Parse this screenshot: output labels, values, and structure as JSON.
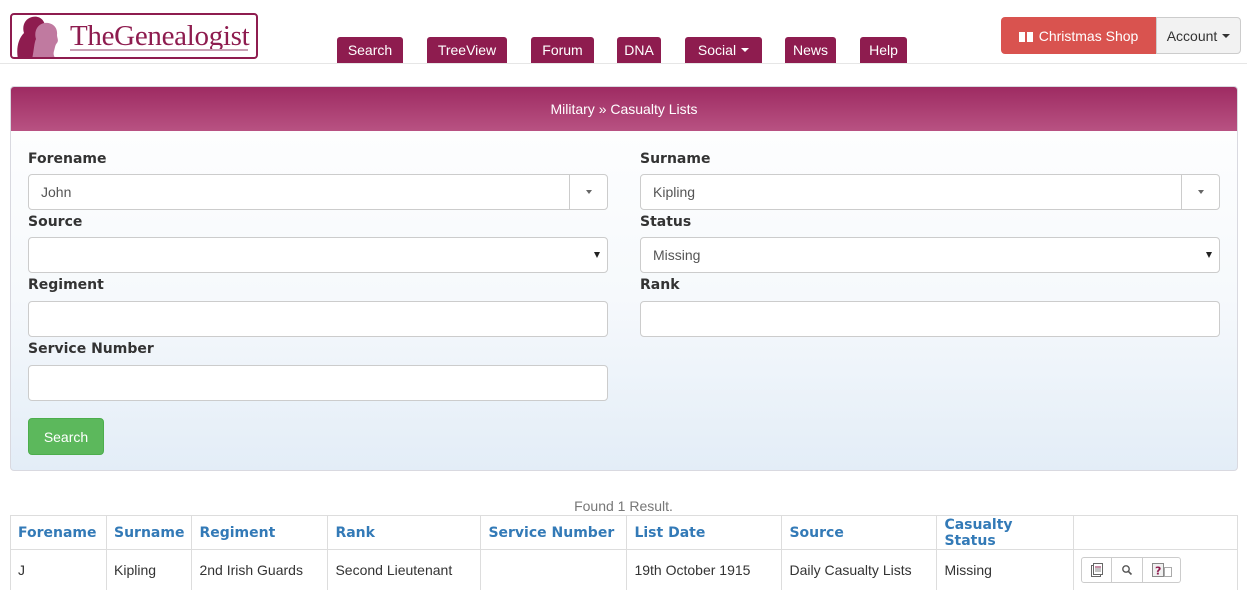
{
  "header": {
    "logo_text": "TheGenealogist",
    "nav": [
      {
        "label": "Search"
      },
      {
        "label": "TreeView"
      },
      {
        "label": "Forum"
      },
      {
        "label": "DNA"
      },
      {
        "label": "Social",
        "dropdown": true
      },
      {
        "label": "News"
      },
      {
        "label": "Help"
      }
    ],
    "christmas_shop": "Christmas Shop",
    "account": "Account",
    "brand_color": "#8e1c4f",
    "shop_color": "#d9534f"
  },
  "panel": {
    "title": "Military » Casualty Lists",
    "fields": {
      "forename": {
        "label": "Forename",
        "value": "John"
      },
      "surname": {
        "label": "Surname",
        "value": "Kipling"
      },
      "source": {
        "label": "Source",
        "value": ""
      },
      "status": {
        "label": "Status",
        "value": "Missing"
      },
      "regiment": {
        "label": "Regiment",
        "value": ""
      },
      "rank": {
        "label": "Rank",
        "value": ""
      },
      "service_number": {
        "label": "Service Number",
        "value": ""
      }
    },
    "search_button": "Search",
    "search_color": "#5cb85c"
  },
  "results": {
    "summary": "Found 1 Result.",
    "columns": [
      "Forename",
      "Surname",
      "Regiment",
      "Rank",
      "Service Number",
      "List Date",
      "Source",
      "Casualty Status",
      ""
    ],
    "rows": [
      {
        "forename": "J",
        "surname": "Kipling",
        "regiment": "2nd Irish Guards",
        "rank": "Second Lieutenant",
        "service_number": "",
        "list_date": "19th October 1915",
        "source": "Daily Casualty Lists",
        "status": "Missing",
        "actions": [
          "document-icon",
          "search-icon",
          "help-icon"
        ]
      }
    ],
    "header_color": "#337ab7"
  }
}
